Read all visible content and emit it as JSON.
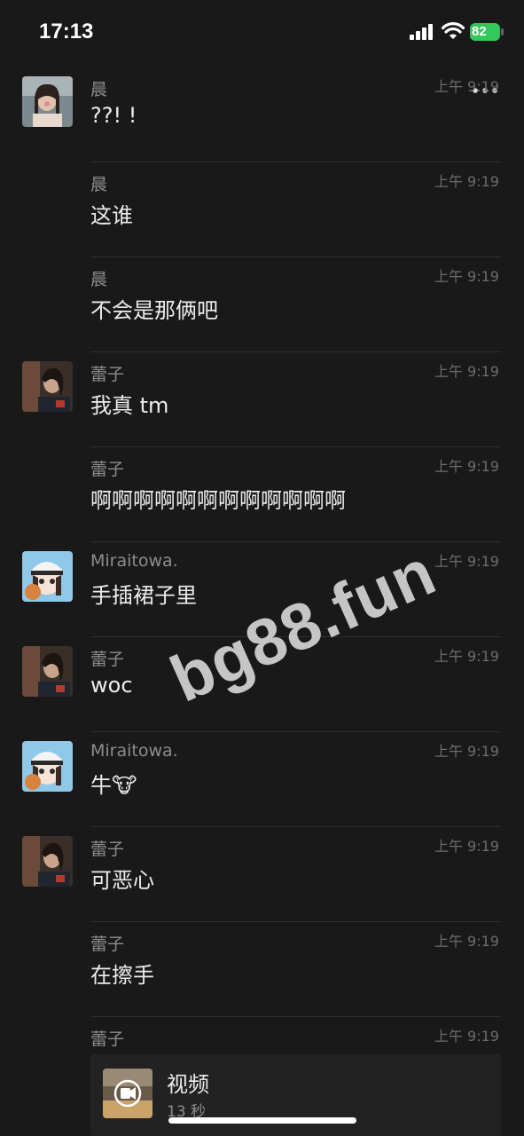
{
  "status_bar": {
    "time": "17:13",
    "battery": "82"
  },
  "header": {
    "back_icon": "chevron-left-icon",
    "more_icon": "more-dots-icon"
  },
  "messages": [
    {
      "sender": "晨",
      "time": "上午 9:19",
      "text": "??! !",
      "avatar": "girl-photo"
    },
    {
      "sender": "晨",
      "time": "上午 9:19",
      "text": "这谁",
      "avatar": ""
    },
    {
      "sender": "晨",
      "time": "上午 9:19",
      "text": "不会是那俩吧",
      "avatar": ""
    },
    {
      "sender": "蕾子",
      "time": "上午 9:19",
      "text": "我真 tm",
      "avatar": "dark-photo"
    },
    {
      "sender": "蕾子",
      "time": "上午 9:19",
      "text": "啊啊啊啊啊啊啊啊啊啊啊啊",
      "avatar": ""
    },
    {
      "sender": "Miraitowa.",
      "time": "上午 9:19",
      "text": "手插裙子里",
      "avatar": "anime-girl"
    },
    {
      "sender": "蕾子",
      "time": "上午 9:19",
      "text": "woc",
      "avatar": "dark-photo"
    },
    {
      "sender": "Miraitowa.",
      "time": "上午 9:19",
      "text": "牛🐮",
      "avatar": "anime-girl"
    },
    {
      "sender": "蕾子",
      "time": "上午 9:19",
      "text": "可恶心",
      "avatar": "dark-photo"
    },
    {
      "sender": "蕾子",
      "time": "上午 9:19",
      "text": "在擦手",
      "avatar": ""
    },
    {
      "sender": "蕾子",
      "time": "上午 9:19",
      "text": "",
      "avatar": ""
    }
  ],
  "video": {
    "title": "视频",
    "duration": "13 秒",
    "icon": "video-play-icon"
  },
  "watermark": "bg88.fun",
  "colors": {
    "background": "#191919",
    "battery": "#34c759"
  }
}
